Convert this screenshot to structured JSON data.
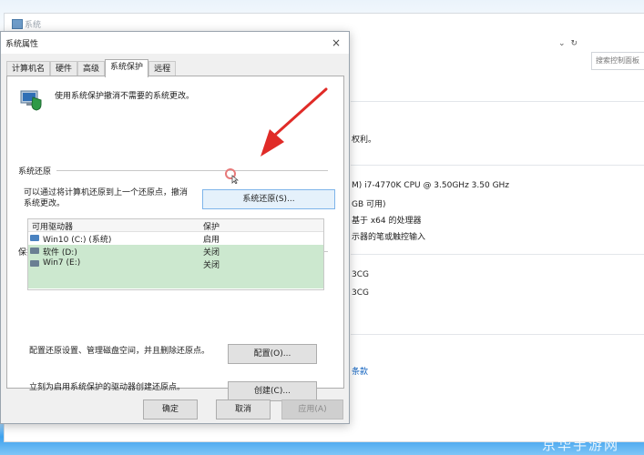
{
  "background": {
    "window_title": "系统",
    "address_refresh": "↻",
    "search_placeholder": "搜索控制面板",
    "text_rights": "权利。",
    "text_cpu": "M) i7-4770K CPU @ 3.50GHz   3.50 GHz",
    "text_ram": "GB 可用)",
    "text_system": "基于 x64 的处理器",
    "text_pen": "示器的笔或触控输入",
    "text_id1": "3CG",
    "text_id2": "3CG",
    "text_terms": "条款"
  },
  "dialog": {
    "title": "系统属性",
    "close": "×",
    "tabs": [
      "计算机名",
      "硬件",
      "高级",
      "系统保护",
      "远程"
    ],
    "active_tab": "系统保护",
    "intro": "使用系统保护撤消不需要的系统更改。",
    "restore_group": "系统还原",
    "restore_desc": [
      "可以通过将计算机还原到上一个还原点，撤消",
      "系统更改。"
    ],
    "restore_button": "系统还原(S)...",
    "protect_group": "保护设置",
    "list_headers": [
      "可用驱动器",
      "保护"
    ],
    "drives": [
      {
        "name": "Win10 (C:) (系统)",
        "status": "启用"
      },
      {
        "name": "软件 (D:)",
        "status": "关闭"
      },
      {
        "name": "Win7 (E:)",
        "status": "关闭"
      }
    ],
    "config_desc": "配置还原设置、管理磁盘空间，并且删除还原点。",
    "config_button": "配置(O)...",
    "create_desc": "立刻为启用系统保护的驱动器创建还原点。",
    "create_button": "创建(C)...",
    "ok": "确定",
    "cancel": "取消",
    "apply": "应用(A)"
  },
  "watermark": "京华手游网",
  "colors": {
    "arrow": "#e02b27",
    "selection": "#cce8cf",
    "taskbar": "#3da1ee"
  }
}
